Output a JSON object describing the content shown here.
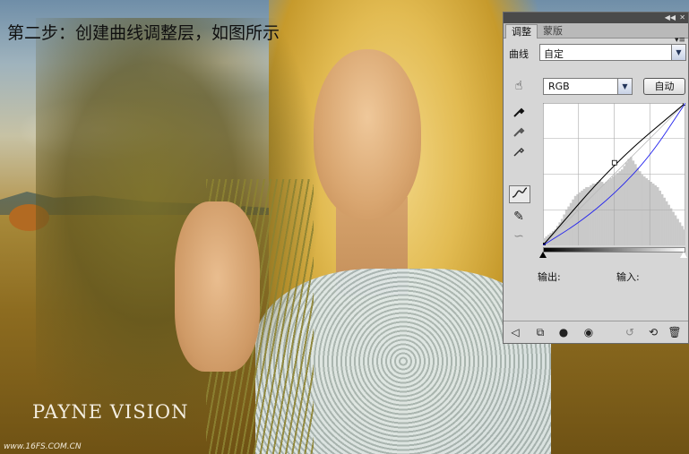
{
  "image": {
    "caption": "第二步：创建曲线调整层，如图所示",
    "brand": "PAYNE VISION",
    "site": "www.16FS.COM.CN"
  },
  "panel": {
    "tabs": [
      {
        "label": "调整",
        "active": true
      },
      {
        "label": "蒙版",
        "active": false
      }
    ],
    "curve_label": "曲线",
    "preset": {
      "selected": "自定"
    },
    "channel": {
      "selected": "RGB"
    },
    "auto_label": "自动",
    "output_label": "输出:",
    "input_label": "输入:",
    "icons": {
      "collapse": "double-chevron-icon",
      "close": "close-icon",
      "menu": "panel-menu-icon",
      "hand": "on-image-adjust-icon",
      "black_dropper": "black-point-eyedropper-icon",
      "gray_dropper": "gray-point-eyedropper-icon",
      "white_dropper": "white-point-eyedropper-icon",
      "curve": "curve-points-icon",
      "pencil": "pencil-draw-icon",
      "smooth": "smooth-curve-icon"
    }
  },
  "chart_data": {
    "type": "line",
    "xlim": [
      0,
      255
    ],
    "ylim": [
      0,
      255
    ],
    "grid": true,
    "series": [
      {
        "color": "#000000",
        "points": [
          [
            0,
            0
          ],
          [
            128,
            148
          ],
          [
            255,
            255
          ]
        ]
      },
      {
        "color": "#2222ee",
        "points": [
          [
            0,
            0
          ],
          [
            64,
            40
          ],
          [
            128,
            92
          ],
          [
            192,
            160
          ],
          [
            255,
            255
          ]
        ]
      }
    ],
    "histogram": [
      8,
      10,
      12,
      14,
      16,
      18,
      22,
      26,
      30,
      35,
      40,
      44,
      48,
      52,
      56,
      58,
      60,
      62,
      64,
      66,
      66,
      68,
      70,
      70,
      72,
      74,
      72,
      70,
      72,
      74,
      76,
      78,
      80,
      82,
      84,
      86,
      90,
      94,
      98,
      100,
      96,
      92,
      88,
      84,
      80,
      78,
      76,
      74,
      72,
      70,
      68,
      66,
      62,
      58,
      54,
      50,
      46,
      42,
      38,
      34,
      30,
      26,
      22,
      18
    ]
  }
}
